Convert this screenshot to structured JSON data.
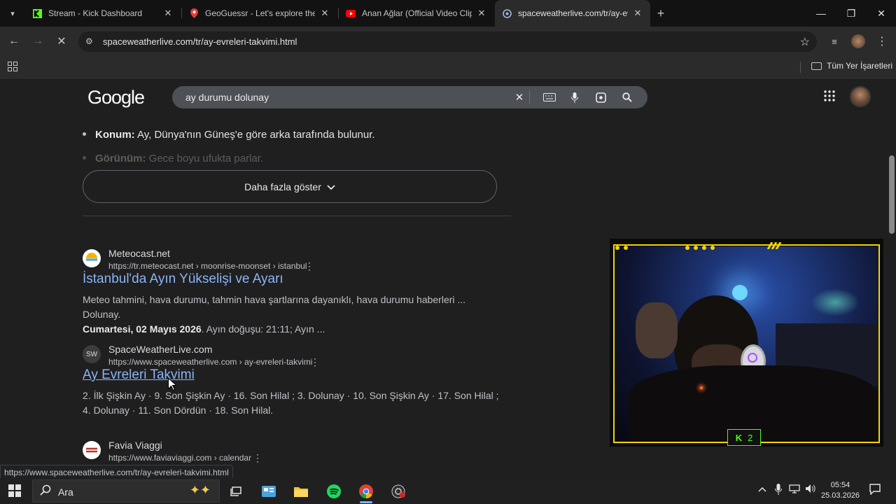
{
  "tabs": [
    {
      "title": "Stream - Kick Dashboard",
      "favicon": "kick-icon"
    },
    {
      "title": "GeoGuessr - Let's explore the w",
      "favicon": "geoguessr-icon"
    },
    {
      "title": "Anan Ağlar (Official Video Clip)",
      "favicon": "youtube-icon"
    },
    {
      "title": "spaceweatherlive.com/tr/ay-ev",
      "favicon": "spaceweather-icon"
    }
  ],
  "omnibox": {
    "url": "spaceweatherlive.com/tr/ay-evreleri-takvimi.html"
  },
  "bookmarks": {
    "all_label": "Tüm Yer İşaretleri"
  },
  "google": {
    "logo": "Google",
    "query": "ay durumu dolunay"
  },
  "bullets": [
    {
      "key": "Konum:",
      "text": " Ay, Dünya'nın Güneş'e göre arka tarafında bulunur."
    },
    {
      "key": "Görünüm:",
      "text": " Gece boyu ufukta parlar."
    }
  ],
  "show_more": "Daha fazla göster",
  "results": [
    {
      "site": "Meteocast.net",
      "url": "https://tr.meteocast.net › moonrise-moonset › istanbul",
      "title": "İstanbul'da Ayın Yükselişi ve Ayarı",
      "snippet_1": "Meteo tahmini, hava durumu, tahmin hava şartlarına dayanıklı, hava durumu haberleri ... Dolunay.",
      "snippet_2_bold": "Cumartesi, 02 Mayıs 2026",
      "snippet_2": ". Ayın doğuşu: 21:11; Ayın ..."
    },
    {
      "site": "SpaceWeatherLive.com",
      "url": "https://www.spaceweatherlive.com › ay-evreleri-takvimi",
      "title": "Ay Evreleri Takvimi",
      "snippet_1": "2. İlk Şişkin Ay · 9. Son Şişkin Ay · 16. Son Hilal ; 3. Dolunay · 10. Son Şişkin Ay · 17. Son Hilal ; 4. Dolunay · 11. Son Dördün · 18. Son Hilal."
    },
    {
      "site": "Favia Viaggi",
      "url": "https://www.faviaviaggi.com › calendar"
    }
  ],
  "status_url": "https://www.spaceweatherlive.com/tr/ay-evreleri-takvimi.html",
  "webcam": {
    "badge": "2"
  },
  "taskbar": {
    "search_label": "Ara",
    "time": "05:54",
    "date": "25.03.2026"
  }
}
